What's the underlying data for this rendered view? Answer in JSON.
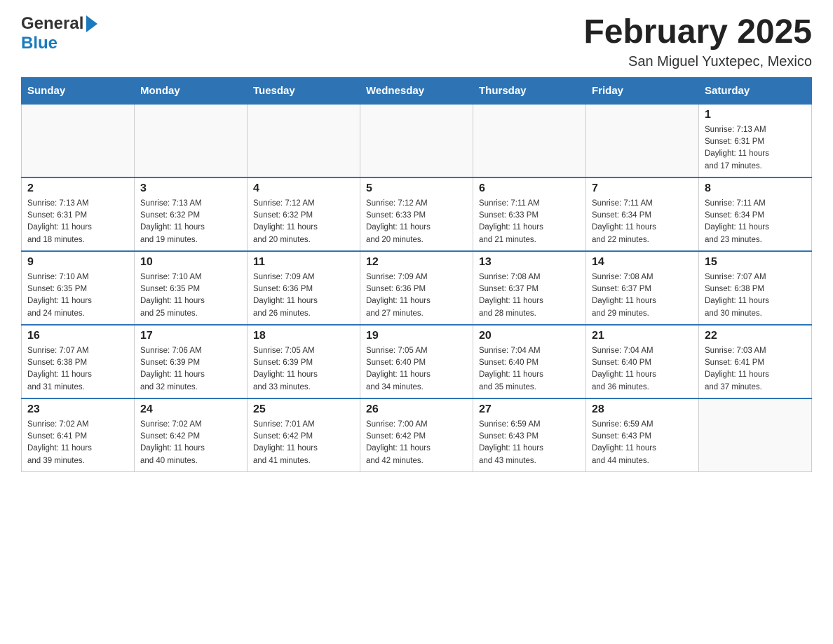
{
  "header": {
    "logo_general": "General",
    "logo_blue": "Blue",
    "month_title": "February 2025",
    "location": "San Miguel Yuxtepec, Mexico"
  },
  "days_of_week": [
    "Sunday",
    "Monday",
    "Tuesday",
    "Wednesday",
    "Thursday",
    "Friday",
    "Saturday"
  ],
  "weeks": [
    {
      "days": [
        {
          "number": "",
          "info": ""
        },
        {
          "number": "",
          "info": ""
        },
        {
          "number": "",
          "info": ""
        },
        {
          "number": "",
          "info": ""
        },
        {
          "number": "",
          "info": ""
        },
        {
          "number": "",
          "info": ""
        },
        {
          "number": "1",
          "info": "Sunrise: 7:13 AM\nSunset: 6:31 PM\nDaylight: 11 hours\nand 17 minutes."
        }
      ]
    },
    {
      "days": [
        {
          "number": "2",
          "info": "Sunrise: 7:13 AM\nSunset: 6:31 PM\nDaylight: 11 hours\nand 18 minutes."
        },
        {
          "number": "3",
          "info": "Sunrise: 7:13 AM\nSunset: 6:32 PM\nDaylight: 11 hours\nand 19 minutes."
        },
        {
          "number": "4",
          "info": "Sunrise: 7:12 AM\nSunset: 6:32 PM\nDaylight: 11 hours\nand 20 minutes."
        },
        {
          "number": "5",
          "info": "Sunrise: 7:12 AM\nSunset: 6:33 PM\nDaylight: 11 hours\nand 20 minutes."
        },
        {
          "number": "6",
          "info": "Sunrise: 7:11 AM\nSunset: 6:33 PM\nDaylight: 11 hours\nand 21 minutes."
        },
        {
          "number": "7",
          "info": "Sunrise: 7:11 AM\nSunset: 6:34 PM\nDaylight: 11 hours\nand 22 minutes."
        },
        {
          "number": "8",
          "info": "Sunrise: 7:11 AM\nSunset: 6:34 PM\nDaylight: 11 hours\nand 23 minutes."
        }
      ]
    },
    {
      "days": [
        {
          "number": "9",
          "info": "Sunrise: 7:10 AM\nSunset: 6:35 PM\nDaylight: 11 hours\nand 24 minutes."
        },
        {
          "number": "10",
          "info": "Sunrise: 7:10 AM\nSunset: 6:35 PM\nDaylight: 11 hours\nand 25 minutes."
        },
        {
          "number": "11",
          "info": "Sunrise: 7:09 AM\nSunset: 6:36 PM\nDaylight: 11 hours\nand 26 minutes."
        },
        {
          "number": "12",
          "info": "Sunrise: 7:09 AM\nSunset: 6:36 PM\nDaylight: 11 hours\nand 27 minutes."
        },
        {
          "number": "13",
          "info": "Sunrise: 7:08 AM\nSunset: 6:37 PM\nDaylight: 11 hours\nand 28 minutes."
        },
        {
          "number": "14",
          "info": "Sunrise: 7:08 AM\nSunset: 6:37 PM\nDaylight: 11 hours\nand 29 minutes."
        },
        {
          "number": "15",
          "info": "Sunrise: 7:07 AM\nSunset: 6:38 PM\nDaylight: 11 hours\nand 30 minutes."
        }
      ]
    },
    {
      "days": [
        {
          "number": "16",
          "info": "Sunrise: 7:07 AM\nSunset: 6:38 PM\nDaylight: 11 hours\nand 31 minutes."
        },
        {
          "number": "17",
          "info": "Sunrise: 7:06 AM\nSunset: 6:39 PM\nDaylight: 11 hours\nand 32 minutes."
        },
        {
          "number": "18",
          "info": "Sunrise: 7:05 AM\nSunset: 6:39 PM\nDaylight: 11 hours\nand 33 minutes."
        },
        {
          "number": "19",
          "info": "Sunrise: 7:05 AM\nSunset: 6:40 PM\nDaylight: 11 hours\nand 34 minutes."
        },
        {
          "number": "20",
          "info": "Sunrise: 7:04 AM\nSunset: 6:40 PM\nDaylight: 11 hours\nand 35 minutes."
        },
        {
          "number": "21",
          "info": "Sunrise: 7:04 AM\nSunset: 6:40 PM\nDaylight: 11 hours\nand 36 minutes."
        },
        {
          "number": "22",
          "info": "Sunrise: 7:03 AM\nSunset: 6:41 PM\nDaylight: 11 hours\nand 37 minutes."
        }
      ]
    },
    {
      "days": [
        {
          "number": "23",
          "info": "Sunrise: 7:02 AM\nSunset: 6:41 PM\nDaylight: 11 hours\nand 39 minutes."
        },
        {
          "number": "24",
          "info": "Sunrise: 7:02 AM\nSunset: 6:42 PM\nDaylight: 11 hours\nand 40 minutes."
        },
        {
          "number": "25",
          "info": "Sunrise: 7:01 AM\nSunset: 6:42 PM\nDaylight: 11 hours\nand 41 minutes."
        },
        {
          "number": "26",
          "info": "Sunrise: 7:00 AM\nSunset: 6:42 PM\nDaylight: 11 hours\nand 42 minutes."
        },
        {
          "number": "27",
          "info": "Sunrise: 6:59 AM\nSunset: 6:43 PM\nDaylight: 11 hours\nand 43 minutes."
        },
        {
          "number": "28",
          "info": "Sunrise: 6:59 AM\nSunset: 6:43 PM\nDaylight: 11 hours\nand 44 minutes."
        },
        {
          "number": "",
          "info": ""
        }
      ]
    }
  ]
}
